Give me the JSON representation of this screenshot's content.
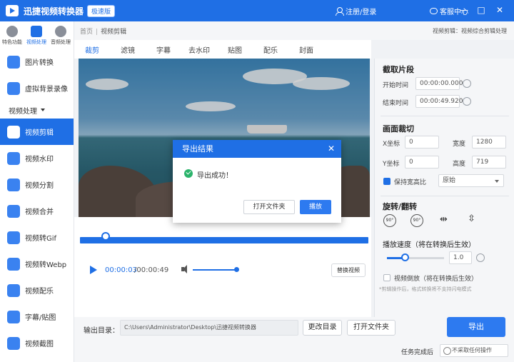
{
  "titlebar": {
    "title": "迅捷视频转换器",
    "badge": "极速版",
    "login": "注册/登录",
    "service": "客服中心",
    "minimize": "—",
    "maximize": "□",
    "close": "✕"
  },
  "sidebar": {
    "top_categories": [
      {
        "label": "特色功能"
      },
      {
        "label": "视频处理"
      },
      {
        "label": "音频处理"
      }
    ],
    "items_before_group": [
      {
        "label": "图片转换"
      },
      {
        "label": "虚拟背景录像"
      }
    ],
    "group_label": "视频处理",
    "items": [
      {
        "label": "视频剪辑"
      },
      {
        "label": "视频水印"
      },
      {
        "label": "视频分割"
      },
      {
        "label": "视频合并"
      },
      {
        "label": "视频转Gif"
      },
      {
        "label": "视频转Webp"
      },
      {
        "label": "视频配乐"
      },
      {
        "label": "字幕/贴图"
      },
      {
        "label": "视频截图"
      }
    ]
  },
  "breadcrumb": {
    "home": "首页",
    "current": "视频剪辑",
    "right_text": "视频剪辑：视频综合剪辑处理"
  },
  "tabs": [
    "裁剪",
    "滤镜",
    "字幕",
    "去水印",
    "贴图",
    "配乐",
    "封面"
  ],
  "player": {
    "current_time": "00:00:03",
    "total_time": "/00:00:49",
    "replace_label": "替换视频"
  },
  "panel": {
    "clip_title": "截取片段",
    "start_label": "开始时间",
    "start_value": "00:00:00.000",
    "end_label": "结束时间",
    "end_value": "00:00:49.920",
    "crop_title": "画面裁切",
    "x_label": "X坐标",
    "x_value": "0",
    "width_label": "宽度",
    "width_value": "1280",
    "y_label": "Y坐标",
    "y_value": "0",
    "height_label": "高度",
    "height_value": "719",
    "keep_ratio": "保持宽高比",
    "ratio_value": "原始",
    "rotate_title": "旋转/翻转",
    "rot_left": "90°",
    "rot_right": "90°",
    "speed_title": "播放速度（将在转换后生效）",
    "speed_value": "1.0",
    "reverse": "视频倒放（将在转换后生效）",
    "note": "*剪辑操作后，格式转换将不支持闪电模式"
  },
  "bottom": {
    "output_label": "输出目录：",
    "output_path": "C:\\Users\\Administrator\\Desktop\\迅捷视频转换器",
    "change_dir": "更改目录",
    "open_folder": "打开文件夹",
    "export": "导出",
    "done_label": "任务完成后",
    "done_value": "不采取任何操作"
  },
  "dialog": {
    "title": "导出结果",
    "message": "导出成功！",
    "open_folder": "打开文件夹",
    "play": "播放",
    "close": "✕"
  },
  "colors": {
    "brand": "#1f6fe5",
    "success": "#2bb36b"
  }
}
